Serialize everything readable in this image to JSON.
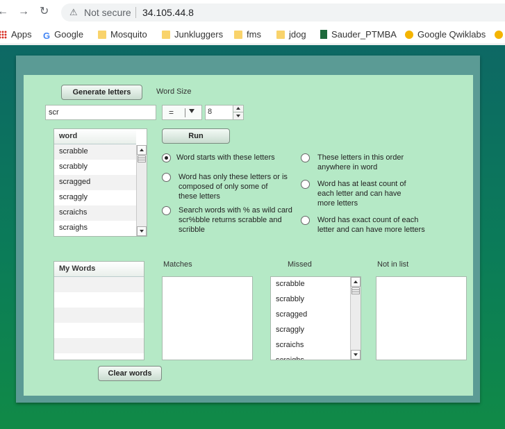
{
  "browser": {
    "security_text": "Not secure",
    "url": "34.105.44.8",
    "bookmarks": [
      "Apps",
      "Google",
      "Mosquito",
      "Junkluggers",
      "fms",
      "jdog",
      "Sauder_PTMBA",
      "Google Qwiklabs"
    ]
  },
  "controls": {
    "generate_label": "Generate letters",
    "word_size_label": "Word Size",
    "letters_value": "scr",
    "operator_value": "=",
    "size_value": "8",
    "run_label": "Run",
    "clear_label": "Clear words"
  },
  "word_list": {
    "header": "word",
    "items": [
      "scrabble",
      "scrabbly",
      "scragged",
      "scraggly",
      "scraichs",
      "scraighs"
    ]
  },
  "options": [
    {
      "label": "Word starts with these letters",
      "checked": true
    },
    {
      "label": "These letters in this order anywhere in word",
      "checked": false
    },
    {
      "label": "Word has only these letters or is composed of only some of these letters",
      "checked": false
    },
    {
      "label": "Word has at least count of each letter and can have more letters",
      "checked": false
    },
    {
      "label": "Search words with % as wild card  scr%bble returns scrabble and scribble",
      "checked": false
    },
    {
      "label": "Word has exact count of each letter and can have more letters",
      "checked": false
    }
  ],
  "my_words": {
    "header": "My Words"
  },
  "matches": {
    "label": "Matches"
  },
  "missed": {
    "label": "Missed",
    "items": [
      "scrabble",
      "scrabbly",
      "scragged",
      "scraggly",
      "scraichs",
      "scraighs"
    ]
  },
  "not_in_list": {
    "label": "Not in list"
  }
}
